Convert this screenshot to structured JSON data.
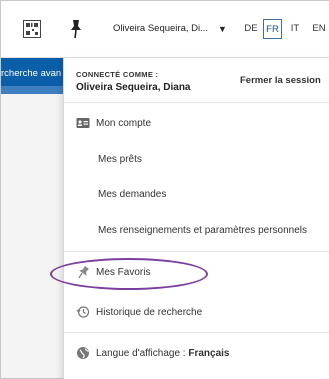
{
  "toolbar": {
    "user_label": "Oliveira Sequeira, Di...",
    "languages": [
      "DE",
      "FR",
      "IT",
      "EN"
    ],
    "active_language": "FR"
  },
  "left": {
    "search_fragment": "rcherche avan"
  },
  "panel": {
    "connected_as": "CONNECTÉ COMME :",
    "user_name": "Oliveira Sequeira, Diana",
    "logout": "Fermer la session",
    "items": {
      "account": "Mon compte",
      "loans": "Mes prêts",
      "requests": "Mes demandes",
      "settings": "Mes renseignements et paramètres personnels",
      "favorites": "Mes Favoris",
      "history": "Historique de recherche",
      "language_label": "Langue d'affichage : ",
      "language_value": "Français"
    }
  },
  "colors": {
    "brand_blue": "#0b5ea8",
    "highlight": "#7b3fa0",
    "active_lang_border": "#3b6fa8"
  }
}
